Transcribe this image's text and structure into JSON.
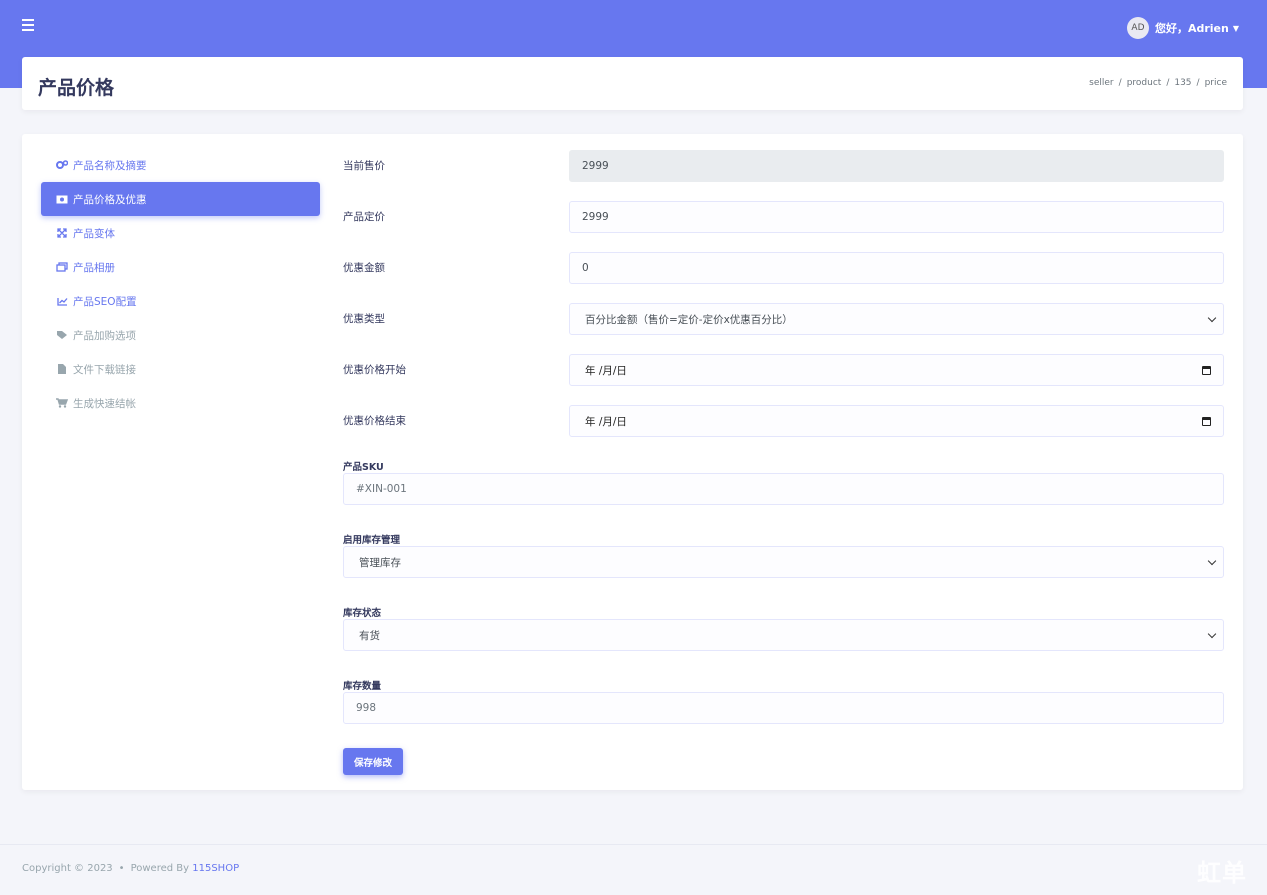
{
  "topbar": {
    "user_initials": "AD",
    "greeting": "您好，",
    "user_name": "Adrien"
  },
  "header": {
    "title": "产品价格",
    "breadcrumb": [
      "seller",
      "product",
      "135",
      "price"
    ]
  },
  "sidebar": {
    "items": [
      {
        "label": "产品名称及摘要",
        "icon": "cogs-icon"
      },
      {
        "label": "产品价格及优惠",
        "icon": "money-icon"
      },
      {
        "label": "产品变体",
        "icon": "expand-icon"
      },
      {
        "label": "产品相册",
        "icon": "images-icon"
      },
      {
        "label": "产品SEO配置",
        "icon": "chart-line-icon"
      },
      {
        "label": "产品加购选项",
        "icon": "tags-icon"
      },
      {
        "label": "文件下载链接",
        "icon": "file-icon"
      },
      {
        "label": "生成快速结帐",
        "icon": "cart-icon"
      }
    ]
  },
  "form": {
    "current_price_label": "当前售价",
    "current_price_value": "2999",
    "list_price_label": "产品定价",
    "list_price_value": "2999",
    "discount_amount_label": "优惠金额",
    "discount_amount_value": "0",
    "discount_type_label": "优惠类型",
    "discount_type_value": "百分比金额（售价=定价-定价x优惠百分比）",
    "discount_start_label": "优惠价格开始",
    "discount_start_value": "年 /月/日",
    "discount_end_label": "优惠价格结束",
    "discount_end_value": "年 /月/日",
    "sku_label": "产品SKU",
    "sku_placeholder": "#XIN-001",
    "stock_mgmt_label": "启用库存管理",
    "stock_mgmt_value": "管理库存",
    "stock_status_label": "库存状态",
    "stock_status_value": "有货",
    "stock_qty_label": "库存数量",
    "stock_qty_placeholder": "998",
    "save_label": "保存修改"
  },
  "footer": {
    "copyright": "Copyright © 2023",
    "powered_by": "Powered By",
    "brand": "115SHOP"
  },
  "watermark": "虹单",
  "colors": {
    "accent": "#6777ef",
    "background": "#f4f5fa"
  }
}
